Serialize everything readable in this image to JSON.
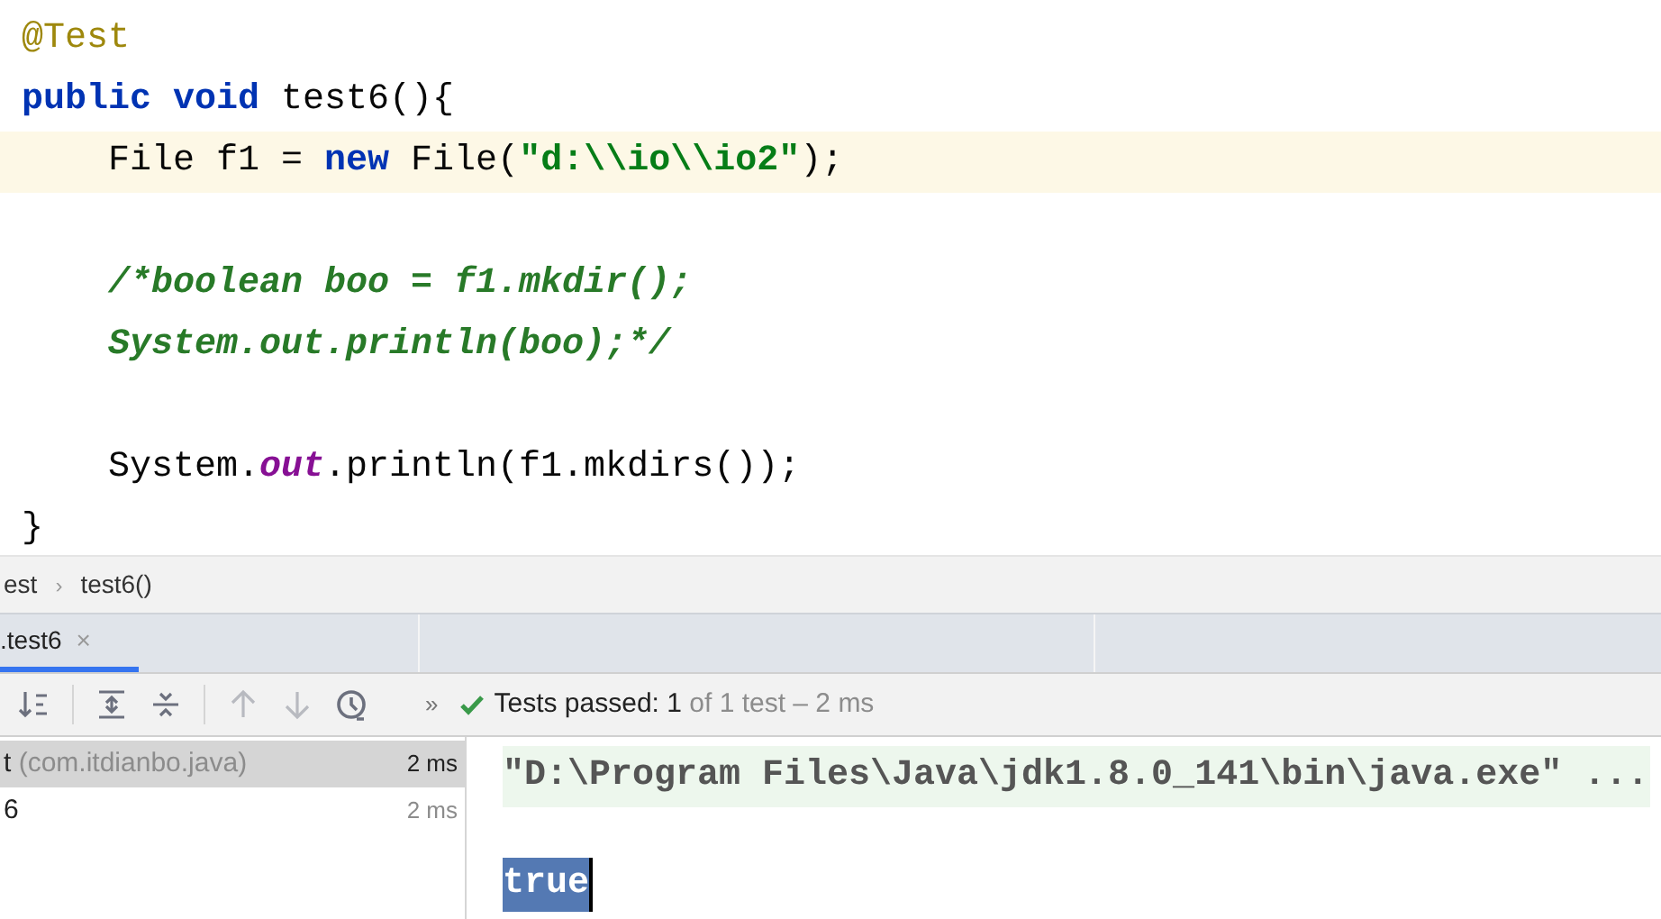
{
  "editor": {
    "lines": [
      {
        "kind": "code",
        "highlighted": false,
        "tokens": [
          {
            "kind": "annotation",
            "text": "@Test"
          }
        ]
      },
      {
        "kind": "code",
        "highlighted": false,
        "tokens": [
          {
            "kind": "keyword",
            "text": "public void "
          },
          {
            "kind": "plain",
            "text": "test6(){"
          }
        ],
        "children": [
          {
            "kind": "code",
            "highlighted": true,
            "tokens": [
              {
                "kind": "plain",
                "text": "File f1 = "
              },
              {
                "kind": "keyword",
                "text": "new "
              },
              {
                "kind": "plain",
                "text": "File("
              },
              {
                "kind": "string",
                "text": "\"d:\\\\io\\\\io2\""
              },
              {
                "kind": "plain",
                "text": ");"
              }
            ]
          },
          {
            "kind": "blank"
          },
          {
            "kind": "code",
            "highlighted": false,
            "tokens": [
              {
                "kind": "comment",
                "text": "/*boolean boo = f1.mkdir();"
              }
            ]
          },
          {
            "kind": "code",
            "highlighted": false,
            "tokens": [
              {
                "kind": "comment",
                "text": "System.out.println(boo);*/"
              }
            ]
          },
          {
            "kind": "blank"
          },
          {
            "kind": "code",
            "highlighted": false,
            "tokens": [
              {
                "kind": "plain",
                "text": "System."
              },
              {
                "kind": "field",
                "text": "out"
              },
              {
                "kind": "plain",
                "text": ".println(f1.mkdirs());"
              }
            ]
          }
        ]
      },
      {
        "kind": "code",
        "highlighted": false,
        "tokens": [
          {
            "kind": "plain",
            "text": "}"
          }
        ]
      }
    ]
  },
  "breadcrumb": {
    "separator": "›",
    "items": [
      "est",
      "test6()"
    ]
  },
  "run_tabs": [
    {
      "label": ".test6",
      "close": "×",
      "selected": true
    }
  ],
  "toolbar": {
    "more": "»",
    "status": {
      "label": "Tests passed:",
      "count": "1",
      "detail": "of 1 test – 2 ms"
    }
  },
  "test_tree": [
    {
      "name": "t",
      "detail": "(com.itdianbo.java)",
      "time": "2 ms",
      "selected": true
    },
    {
      "name": "6",
      "time": "2 ms",
      "selected": false
    }
  ],
  "console": [
    {
      "kind": "command",
      "text": "\"D:\\Program Files\\Java\\jdk1.8.0_141\\bin\\java.exe\" ..."
    },
    {
      "kind": "blank"
    },
    {
      "kind": "selected",
      "text": "true"
    }
  ]
}
